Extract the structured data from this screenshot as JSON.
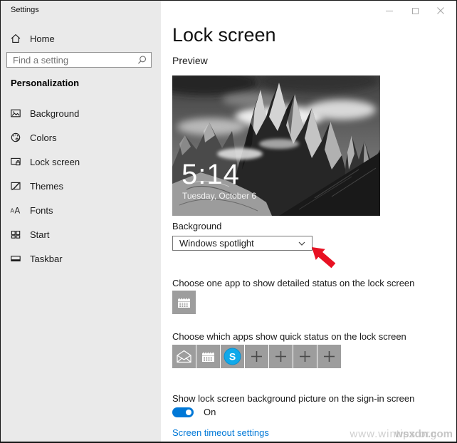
{
  "window": {
    "title": "Settings",
    "controls": [
      "minimize",
      "maximize",
      "close"
    ],
    "close_glyph": "✕"
  },
  "sidebar": {
    "home_label": "Home",
    "search": {
      "placeholder": "Find a setting"
    },
    "section": "Personalization",
    "items": [
      {
        "label": "Background",
        "icon": "image-icon"
      },
      {
        "label": "Colors",
        "icon": "palette-icon"
      },
      {
        "label": "Lock screen",
        "icon": "lock-screen-icon"
      },
      {
        "label": "Themes",
        "icon": "themes-icon"
      },
      {
        "label": "Fonts",
        "icon": "fonts-icon"
      },
      {
        "label": "Start",
        "icon": "start-icon"
      },
      {
        "label": "Taskbar",
        "icon": "taskbar-icon"
      }
    ]
  },
  "main": {
    "title": "Lock screen",
    "preview_label": "Preview",
    "preview": {
      "time": "5:14",
      "date": "Tuesday, October 6"
    },
    "background": {
      "label": "Background",
      "value": "Windows spotlight"
    },
    "detailed_status": {
      "label": "Choose one app to show detailed status on the lock screen",
      "apps": [
        "calendar-icon"
      ]
    },
    "quick_status": {
      "label": "Choose which apps show quick status on the lock screen",
      "apps": [
        "mail-icon",
        "calendar-icon",
        "skype-icon",
        "add-icon",
        "add-icon",
        "add-icon",
        "add-icon"
      ]
    },
    "signin_toggle": {
      "label": "Show lock screen background picture on the sign-in screen",
      "state": "On"
    },
    "timeout_link": "Screen timeout settings"
  },
  "watermarks": {
    "site": "www.wintips.org",
    "overlay": "wsxdn.com"
  },
  "colors": {
    "accent": "#0078d7",
    "link": "#0078d7",
    "skype_blue": "#0fa9ea",
    "tile_gray": "#9d9d9d",
    "annotation_red": "#e81123",
    "sidebar_bg": "#eaeaea"
  }
}
